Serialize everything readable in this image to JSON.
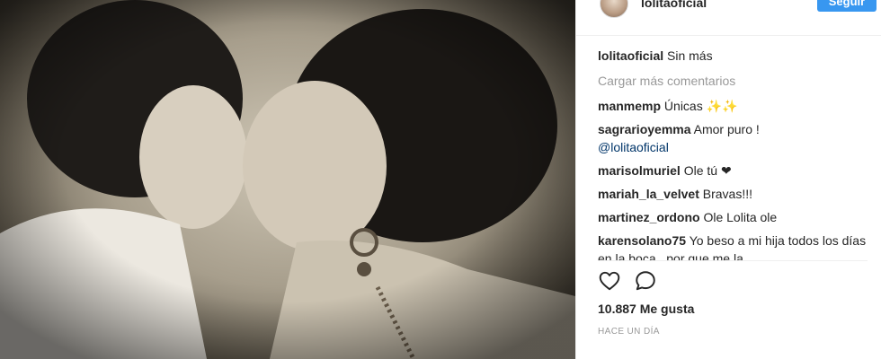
{
  "post": {
    "author": "lolitaoficial",
    "follow_label": "Seguir",
    "caption_user": "lolitaoficial",
    "caption_text": "Sin más",
    "load_more": "Cargar más comentarios"
  },
  "comments": [
    {
      "user": "manmemp",
      "text": "Únicas ✨✨"
    },
    {
      "user": "sagrarioyemma",
      "text": "Amor puro !",
      "mention": "@lolitaoficial"
    },
    {
      "user": "marisolmuriel",
      "text": "Ole tú ❤"
    },
    {
      "user": "mariah_la_velvet",
      "text": "Bravas!!!"
    },
    {
      "user": "martinez_ordono",
      "text": "Ole Lolita ole"
    },
    {
      "user": "karensolano75",
      "text": "Yo beso a mi hija todos los días en la boca , por que me la"
    }
  ],
  "stats": {
    "likes": "10.887 Me gusta",
    "time": "HACE UN DÍA"
  },
  "icons": {
    "like": "heart-icon",
    "comment": "comment-icon"
  },
  "colors": {
    "follow_button": "#3897f0",
    "muted_text": "#999999",
    "mention": "#003569"
  }
}
